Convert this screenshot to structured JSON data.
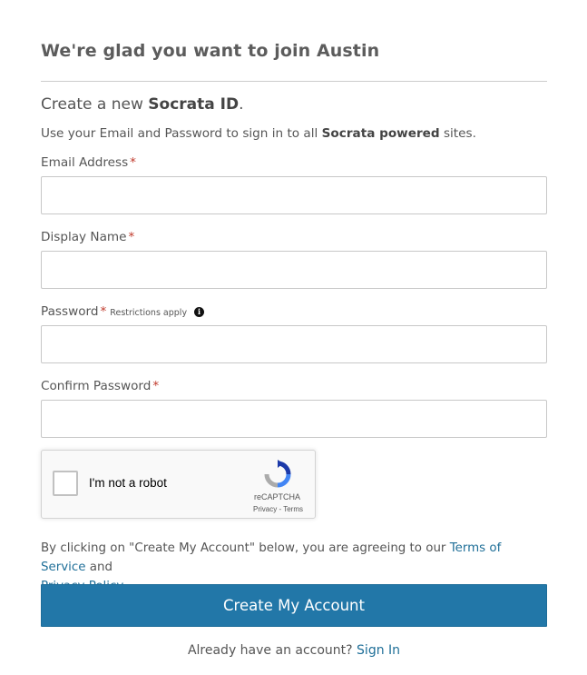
{
  "page": {
    "title": "We're glad you want to join Austin"
  },
  "intro": {
    "subtitle_prefix": "Create a new ",
    "subtitle_bold": "Socrata ID",
    "subtitle_suffix": ".",
    "text_prefix": "Use your Email and Password to sign in to all ",
    "text_bold": "Socrata powered",
    "text_suffix": " sites."
  },
  "form": {
    "required_marker": "*",
    "email": {
      "label": "Email Address",
      "value": ""
    },
    "display_name": {
      "label": "Display Name",
      "value": ""
    },
    "password": {
      "label": "Password",
      "value": "",
      "restrictions": "Restrictions apply",
      "info_glyph": "i"
    },
    "confirm_password": {
      "label": "Confirm Password",
      "value": ""
    }
  },
  "recaptcha": {
    "label": "I'm not a robot",
    "brand": "reCAPTCHA",
    "privacy": "Privacy",
    "separator": " - ",
    "terms": "Terms",
    "colors": {
      "blue": "#1c3aa9",
      "light_blue": "#4285f4",
      "gray": "#ababab"
    }
  },
  "agreement": {
    "prefix": "By clicking on \"Create My Account\" below, you are agreeing to our ",
    "terms_link": "Terms of Service",
    "middle": " and ",
    "privacy_link": "Privacy Policy",
    "suffix": "."
  },
  "actions": {
    "create_label": "Create My Account",
    "signin_prompt": "Already have an account? ",
    "signin_link": "Sign In"
  },
  "colors": {
    "accent": "#2277a8",
    "link": "#1f6f98",
    "required": "#c0392b"
  }
}
